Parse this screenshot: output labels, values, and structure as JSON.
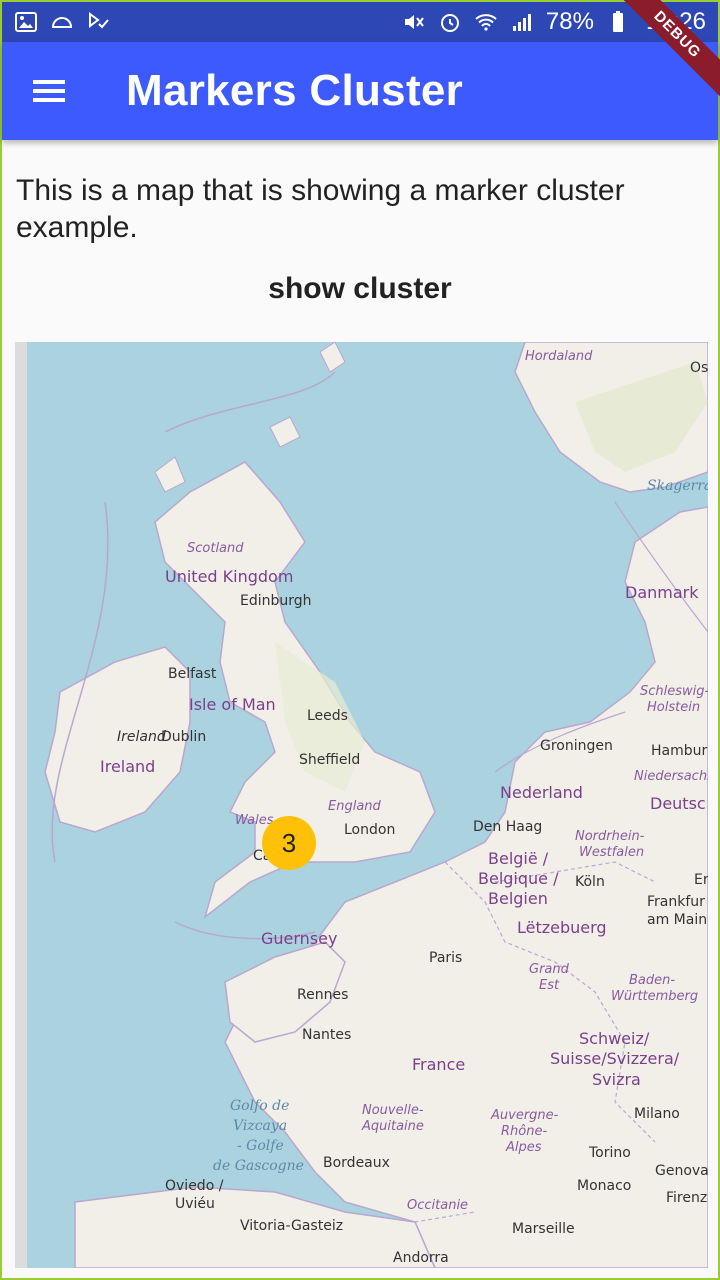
{
  "status_bar": {
    "battery_percent": "78%",
    "time": "18:26"
  },
  "app_bar": {
    "title": "Markers Cluster"
  },
  "debug_banner": "DEBUG",
  "content": {
    "intro_text": "This is a map that is showing a marker cluster example.",
    "show_cluster_label": "show cluster"
  },
  "map": {
    "cluster_count": "3",
    "labels": {
      "hordaland": "Hordaland",
      "os": "Os",
      "skagerrak": "Skagerrak",
      "scotland": "Scotland",
      "united_kingdom": "United Kingdom",
      "edinburgh": "Edinburgh",
      "danmark": "Danmark",
      "belfast": "Belfast",
      "isle_of_man": "Isle of Man",
      "schleswig": "Schleswig-",
      "holstein": "Holstein",
      "leeds": "Leeds",
      "ireland_italic": "Ireland",
      "dublin": "Dublin",
      "groningen": "Groningen",
      "hamburg": "Hambur",
      "ireland": "Ireland",
      "sheffield": "Sheffield",
      "niedersachsen": "Niedersachs",
      "nederland": "Nederland",
      "deutsch": "Deutsc",
      "england": "England",
      "wales": "Wales",
      "london": "London",
      "den_haag": "Den Haag",
      "nordrhein": "Nordrhein-",
      "westfalen": "Westfalen",
      "cardiff": "Ca",
      "belgie1": "België /",
      "belgie2": "Belgique /",
      "belgie3": "Belgien",
      "koln": "Köln",
      "er": "Er",
      "frankfurt1": "Frankfur",
      "frankfurt2": "am Main",
      "letzebuerg": "Lëtzebuerg",
      "guernsey": "Guernsey",
      "paris": "Paris",
      "grand_est1": "Grand",
      "grand_est2": "Est",
      "baden1": "Baden-",
      "baden2": "Württemberg",
      "rennes": "Rennes",
      "nantes": "Nantes",
      "schweiz1": "Schweiz/",
      "schweiz2": "Suisse/Svizzera/",
      "schweiz3": "Svizra",
      "france": "France",
      "golfo1": "Golfo de",
      "golfo2": "Vizcaya",
      "golfo3": "- Golfe",
      "golfo4": "de Gascogne",
      "nouvelle1": "Nouvelle-",
      "nouvelle2": "Aquitaine",
      "auvergne1": "Auvergne-",
      "auvergne2": "Rhône-",
      "auvergne3": "Alpes",
      "milano": "Milano",
      "bordeaux": "Bordeaux",
      "torino": "Torino",
      "oviedo1": "Oviedo /",
      "oviedo2": "Uviéu",
      "monaco": "Monaco",
      "genova": "Genova",
      "firenze": "Firenz",
      "occitanie": "Occitanie",
      "vitoria": "Vitoria-Gasteiz",
      "marseille": "Marseille",
      "andorra": "Andorra"
    }
  }
}
